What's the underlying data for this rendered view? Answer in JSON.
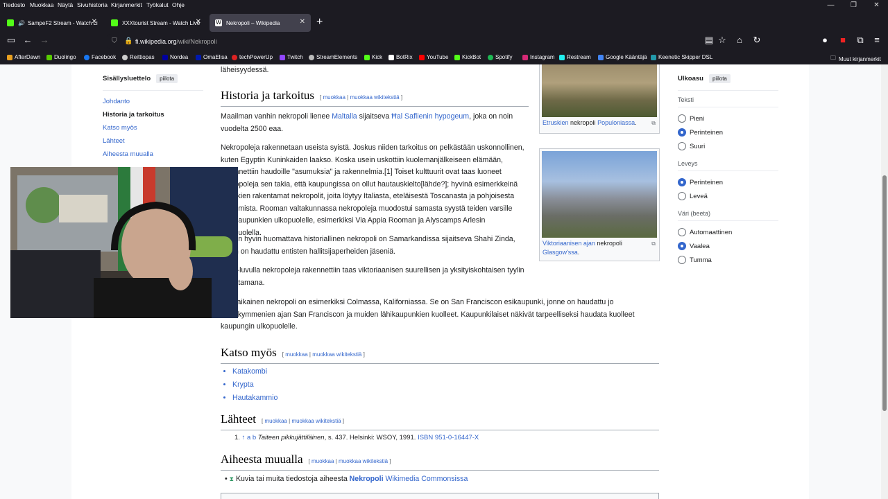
{
  "menu": [
    "Tiedosto",
    "Muokkaa",
    "Näytä",
    "Sivuhistoria",
    "Kirjanmerkit",
    "Työkalut",
    "Ohje"
  ],
  "tabs": [
    {
      "title": "SampeF2 Stream - Watch Li",
      "icon_color": "#53fc18"
    },
    {
      "title": "XXXtourist Stream - Watch Live",
      "icon_color": "#53fc18"
    },
    {
      "title": "Nekropoli – Wikipedia",
      "icon_color": "#ffffff"
    }
  ],
  "url": {
    "host": "fi.wikipedia.org",
    "path": "/wiki/Nekropoli"
  },
  "bookmarks": [
    "AfterDawn",
    "Duolingo",
    "Facebook",
    "Reittiopas",
    "Nordea",
    "OmaElisa",
    "techPowerUp",
    "Twitch",
    "StreamElements",
    "Kick",
    "BotRix",
    "YouTube",
    "KickBot",
    "Spotify",
    "Instagram",
    "Restream",
    "Google Kääntäjä",
    "Keenetic Skipper DSL"
  ],
  "other_bookmarks": "Muut kirjanmerkit",
  "toc": {
    "title": "Sisällysluettelo",
    "hide": "piilota",
    "items": [
      "Johdanto",
      "Historia ja tarkoitus",
      "Katso myös",
      "Lähteet",
      "Aiheesta muualla"
    ]
  },
  "article": {
    "top_fragment": "läheisyydessä.",
    "edit": "muokkaa",
    "edit_source": "muokkaa wikitekstiä",
    "h_history": "Historia ja tarkoitus",
    "p1a": "Maailman vanhin nekropoli lienee ",
    "p1b": "Maltalla",
    "p1c": " sijaitseva ",
    "p1d": "Ħal Saflienin hypogeum",
    "p1e": ", joka on noin vuodelta 2500 eaa.",
    "p2": "Nekropoleja rakennetaan useista syistä. Joskus niiden tarkoitus on pelkästään uskonnollinen, kuten Egyptin Kuninkaiden laakso. Koska usein uskottiin kuolemanjälkeiseen elämään, rakennettiin haudoille \"asumuksia\" ja rakennelmia.[1] Toiset kulttuurit ovat taas luoneet nekropoleja sen takia, että kaupungissa on ollut hautauskielto[lähde?]; hyvinä esimerkkeinä etruskien rakentamat nekropolit, joita löytyy Italiasta, eteläisestä Toscanasta ja pohjoisesta Laziumista. Rooman valtakunnassa nekropoleja muodostui samasta syystä teiden varsille heti kaupunkien ulkopuolelle, esimerkiksi Via Appia Rooman ja Alyscamps Arlesin ulkopuolella.",
    "p3": "Toinen hyvin huomattava historiallinen nekropoli on Samarkandissa sijaitseva Shahi Zinda, johon on haudattu entisten hallitsijaperheiden jäseniä.",
    "p4": "1800-luvulla nekropoleja rakennettiin taas viktoriaanisen suurellisen ja yksityiskohtaisen tyylin innoittamana.",
    "p5": "Nykyaikainen nekropoli on esimerkiksi Colmassa, Kaliforniassa. Se on San Franciscon esikaupunki, jonne on haudattu jo vuosikymmenien ajan San Franciscon ja muiden lähikaupunkien kuolleet. Kaupunkilaiset näkivät tarpeelliseksi haudata kuolleet kaupungin ulkopuolelle.",
    "h_see": "Katso myös",
    "see": [
      "Katakombi",
      "Krypta",
      "Hautakammio"
    ],
    "h_refs": "Lähteet",
    "ref_a": "↑ a b ",
    "ref_b": "Taiteen pikkujättiläinen",
    "ref_c": ", s. 437. Helsinki: WSOY, 1991. ",
    "ref_isbn": "ISBN 951-0-16447-X",
    "h_ext": "Aiheesta muualla",
    "ext_a": "Kuvia tai muita tiedostoja aiheesta ",
    "ext_b": "Nekropoli",
    "ext_c": " Wikimedia Commonsissa",
    "cap1a": "Etruskien",
    "cap1b": " nekropoli ",
    "cap1c": "Populoniassa",
    "cap2a": "Viktoriaanisen ajan",
    "cap2b": " nekropoli ",
    "cap2c": "Glasgow'ssa"
  },
  "appearance": {
    "title": "Ulkoasu",
    "hide": "piilota",
    "groups": [
      {
        "label": "Teksti",
        "options": [
          "Pieni",
          "Perinteinen",
          "Suuri"
        ],
        "selected": 1
      },
      {
        "label": "Leveys",
        "options": [
          "Perinteinen",
          "Leveä"
        ],
        "selected": 0
      },
      {
        "label": "Väri (beeta)",
        "options": [
          "Automaattinen",
          "Vaalea",
          "Tumma"
        ],
        "selected": 1
      }
    ]
  }
}
